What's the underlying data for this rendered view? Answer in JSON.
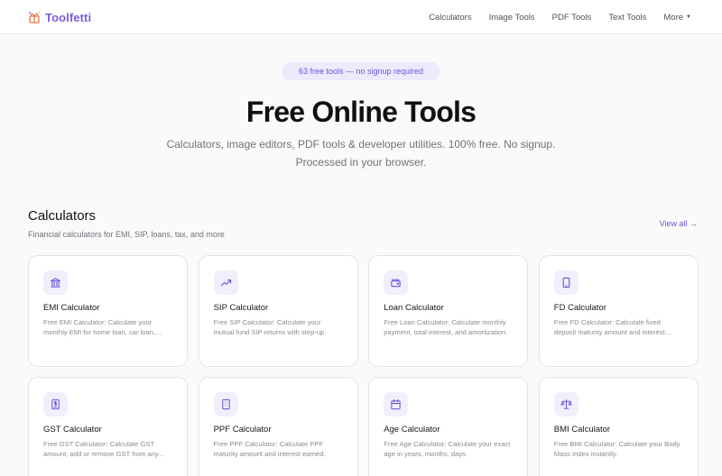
{
  "brand": {
    "name": "Toolfetti",
    "accent": "#7c5ce0",
    "logo_icon": "confetti-gift-icon"
  },
  "nav": {
    "links": [
      "Calculators",
      "Image Tools",
      "PDF Tools",
      "Text Tools"
    ],
    "more_label": "More"
  },
  "hero": {
    "pill": "63 free tools — no signup required",
    "title": "Free Online Tools",
    "subtitle_line1": "Calculators, image editors, PDF tools & developer utilities. 100% free. No signup.",
    "subtitle_line2": "Processed in your browser."
  },
  "section": {
    "title": "Calculators",
    "subtitle": "Financial calculators for EMI, SIP, loans, tax, and more",
    "view_all": "View all →"
  },
  "cards": [
    {
      "icon": "bank-icon",
      "title": "EMI Calculator",
      "desc": "Free EMI Calculator: Calculate your monthly EMI for home loan, car loan, personal loan and more."
    },
    {
      "icon": "trending-up-icon",
      "title": "SIP Calculator",
      "desc": "Free SIP Calculator: Calculate your mutual fund SIP returns with step-up."
    },
    {
      "icon": "wallet-icon",
      "title": "Loan Calculator",
      "desc": "Free Loan Calculator: Calculate monthly payment, total interest, and amortization."
    },
    {
      "icon": "tablet-icon",
      "title": "FD Calculator",
      "desc": "Free FD Calculator: Calculate fixed deposit maturity amount and interest earned."
    },
    {
      "icon": "receipt-icon",
      "title": "GST Calculator",
      "desc": "Free GST Calculator: Calculate GST amount, add or remove GST from any amount instantly."
    },
    {
      "icon": "building-icon",
      "title": "PPF Calculator",
      "desc": "Free PPF Calculator: Calculate PPF maturity amount and interest earned."
    },
    {
      "icon": "calendar-icon",
      "title": "Age Calculator",
      "desc": "Free Age Calculator: Calculate your exact age in years, months, days."
    },
    {
      "icon": "scale-icon",
      "title": "BMI Calculator",
      "desc": "Free BMI Calculator: Calculate your Body Mass Index instantly."
    }
  ]
}
